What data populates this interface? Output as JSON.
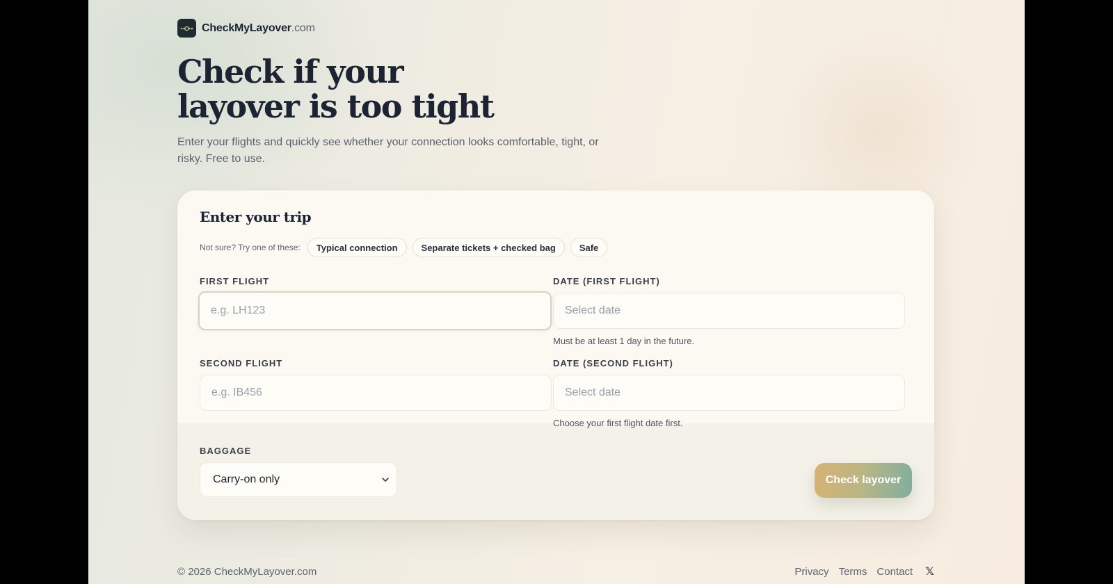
{
  "brand": {
    "name": "CheckMyLayover",
    "tld": ".com",
    "logo_icon": "plane-dots-icon"
  },
  "hero": {
    "title_line1": "Check if your",
    "title_line2": "layover is too tight",
    "subtitle": "Enter your flights and quickly see whether your connection looks comfortable, tight, or risky. Free to use."
  },
  "form": {
    "title": "Enter your trip",
    "suggest_label": "Not sure? Try one of these:",
    "chips": [
      "Typical connection",
      "Separate tickets + checked bag",
      "Safe"
    ],
    "first_flight": {
      "label": "FIRST FLIGHT",
      "placeholder": "e.g. LH123",
      "value": ""
    },
    "first_date": {
      "label": "DATE (FIRST FLIGHT)",
      "placeholder": "Select date",
      "helper": "Must be at least 1 day in the future."
    },
    "second_flight": {
      "label": "SECOND FLIGHT",
      "placeholder": "e.g. IB456",
      "value": ""
    },
    "second_date": {
      "label": "DATE (SECOND FLIGHT)",
      "placeholder": "Select date",
      "helper": "Choose your first flight date first."
    },
    "baggage": {
      "label": "BAGGAGE",
      "selected": "Carry-on only"
    },
    "submit_label": "Check layover"
  },
  "footer": {
    "copyright": "© 2026 CheckMyLayover.com",
    "links": [
      "Privacy",
      "Terms",
      "Contact"
    ],
    "social_icon": "x-logo-icon"
  },
  "colors": {
    "ink": "#1c2433",
    "card": "#fbf9f1",
    "button_gradient_start": "#d8b273",
    "button_gradient_end": "#7fae9e"
  }
}
